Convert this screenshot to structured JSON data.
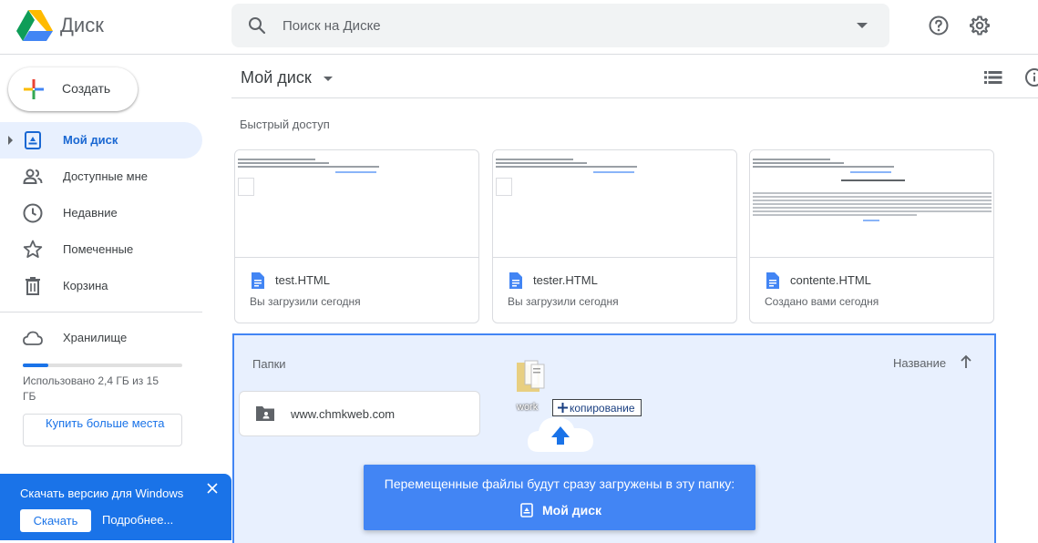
{
  "app": {
    "name": "Диск"
  },
  "search": {
    "placeholder": "Поиск на Диске"
  },
  "sidebar": {
    "create_label": "Создать",
    "items": [
      {
        "label": "Мой диск",
        "icon": "my-drive-icon",
        "active": true
      },
      {
        "label": "Доступные мне",
        "icon": "people-icon",
        "active": false
      },
      {
        "label": "Недавние",
        "icon": "clock-icon",
        "active": false
      },
      {
        "label": "Помеченные",
        "icon": "star-icon",
        "active": false
      },
      {
        "label": "Корзина",
        "icon": "trash-icon",
        "active": false
      }
    ],
    "storage": {
      "label": "Хранилище",
      "usage_text": "Использовано 2,4 ГБ из 15 ГБ",
      "usage_fraction": 0.16,
      "buy_label": "Купить больше места"
    }
  },
  "download_banner": {
    "title": "Скачать версию для Windows",
    "download_label": "Скачать",
    "more_label": "Подробнее..."
  },
  "main": {
    "title": "Мой диск",
    "quick_access_title": "Быстрый доступ",
    "files": [
      {
        "name": "test.HTML",
        "meta": "Вы загрузили сегодня"
      },
      {
        "name": "tester.HTML",
        "meta": "Вы загрузили сегодня"
      },
      {
        "name": "contente.HTML",
        "meta": "Создано вами сегодня"
      }
    ],
    "folders_label": "Папки",
    "sort_label": "Название",
    "folders": [
      {
        "name": "www.chmkweb.com"
      }
    ]
  },
  "drag": {
    "item_name": "work",
    "action_label": "копирование"
  },
  "toast": {
    "message": "Перемещенные файлы будут сразу загружены в эту папку:",
    "target": "Мой диск"
  },
  "colors": {
    "accent": "#1a73e8",
    "active_bg": "#e8f0fe",
    "drop_blue": "#4285f4"
  }
}
